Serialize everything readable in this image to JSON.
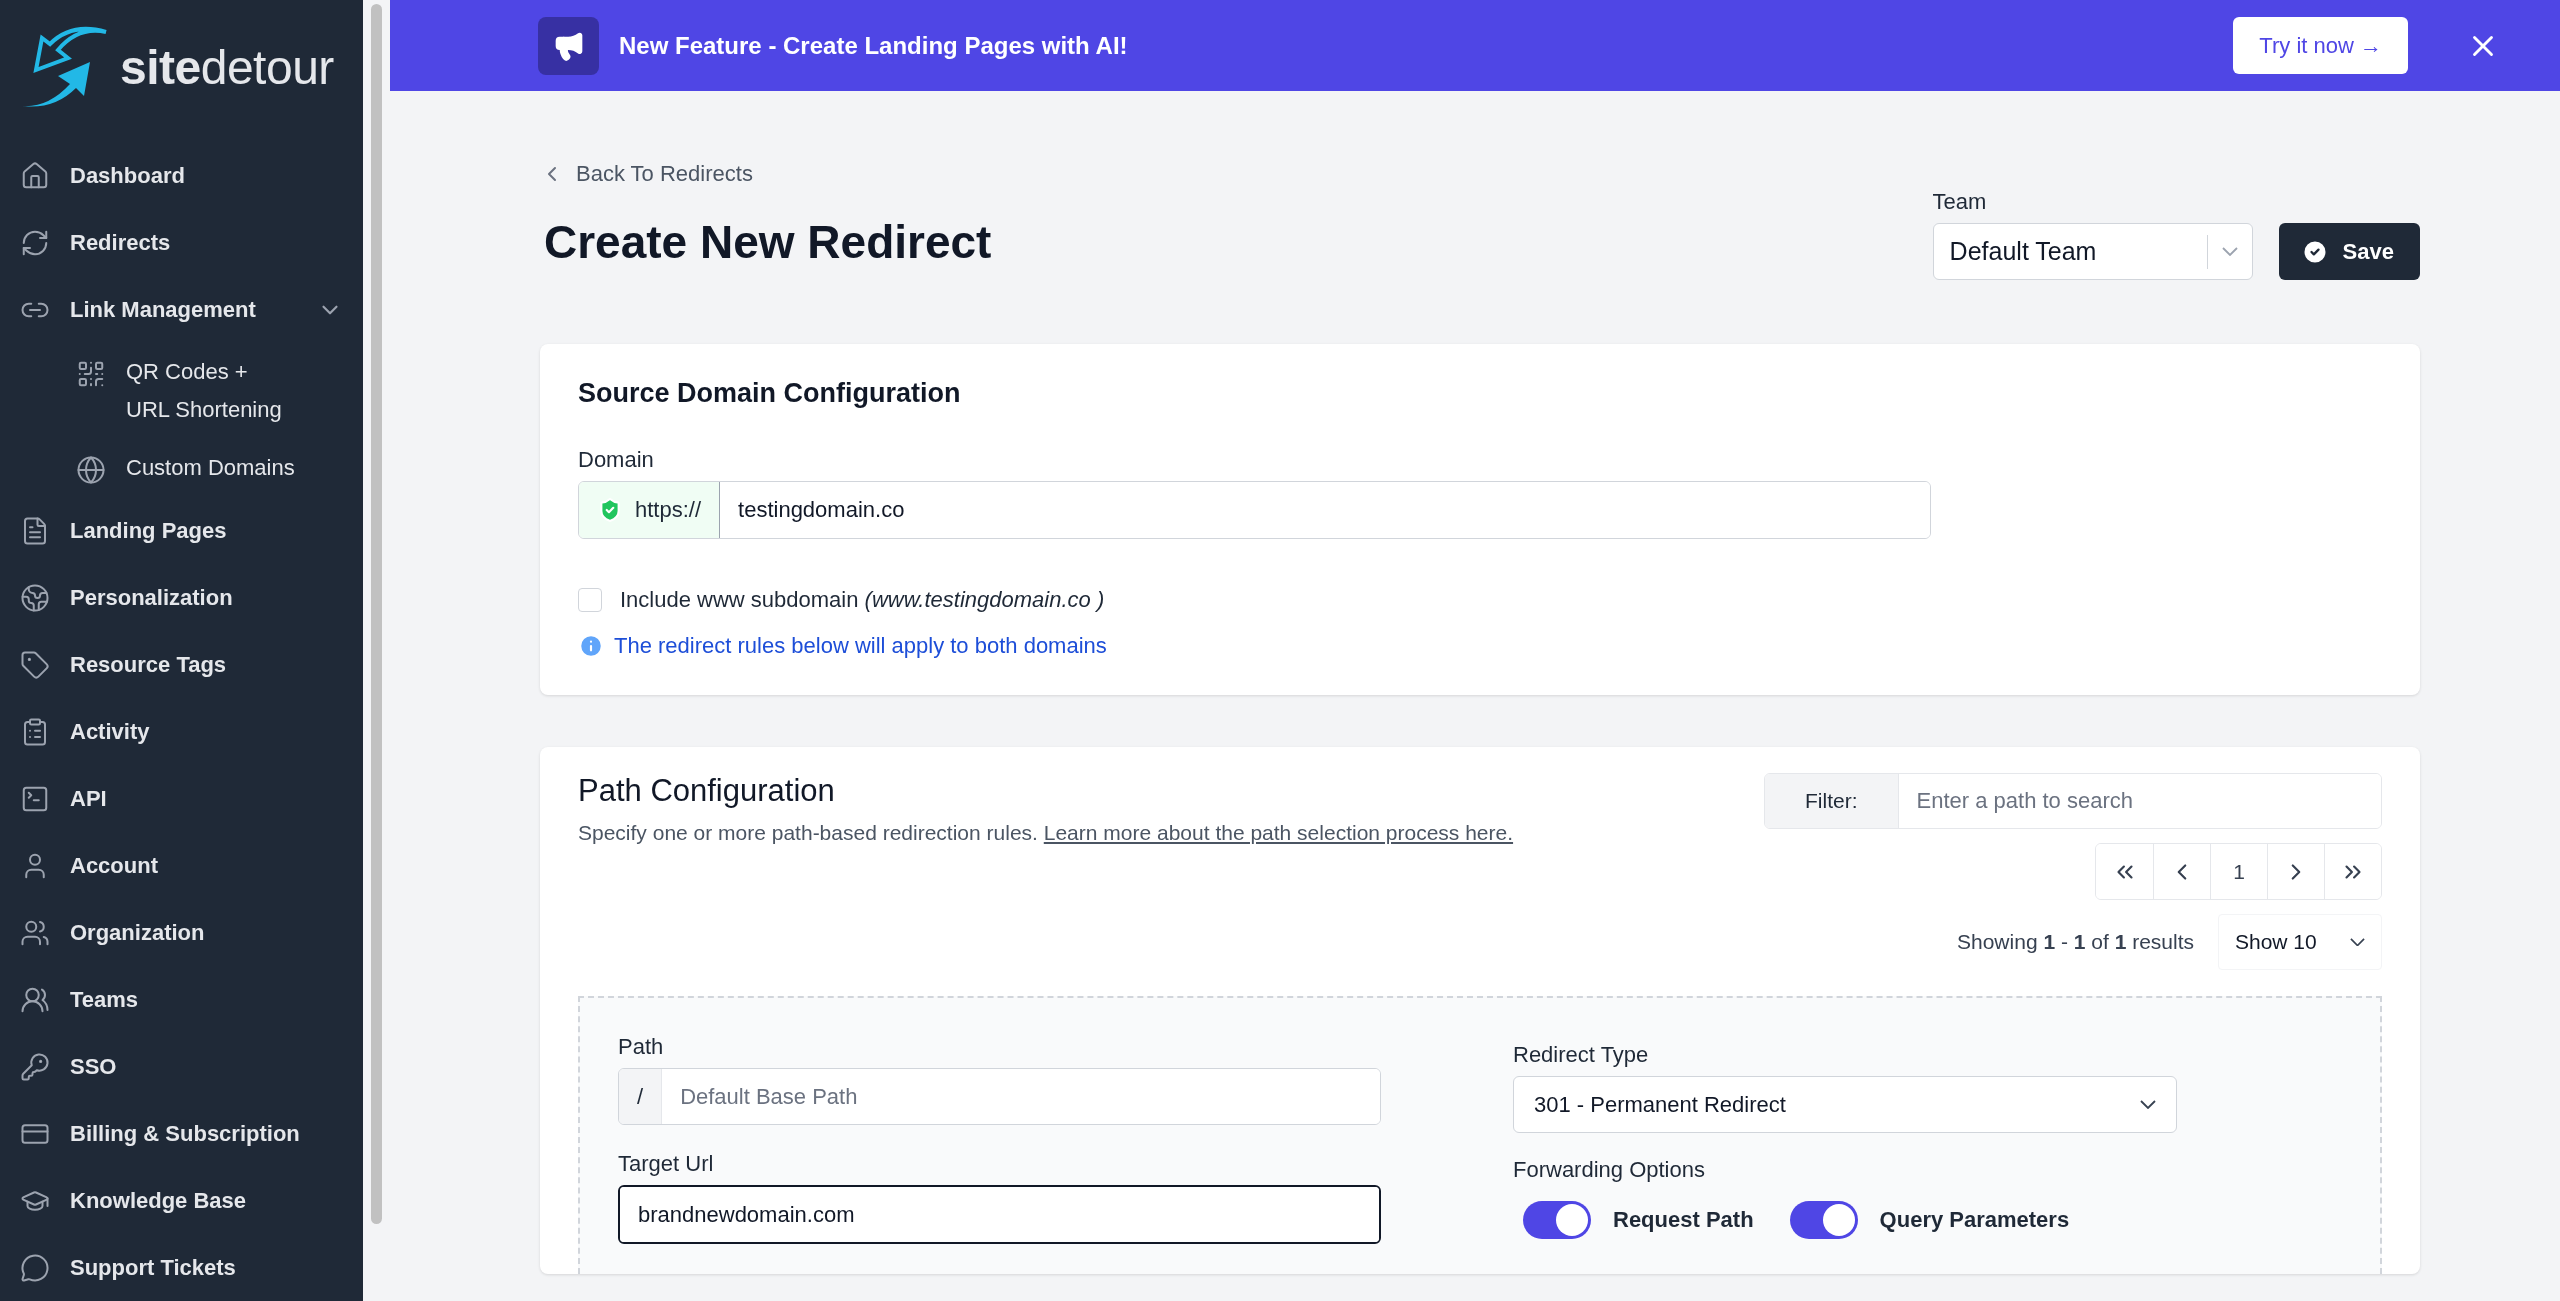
{
  "sidebar": {
    "logo": {
      "part1": "site",
      "part2": "detour"
    },
    "items": [
      {
        "label": "Dashboard",
        "selected": false
      },
      {
        "label": "Redirects",
        "selected": false
      },
      {
        "label": "Link Management",
        "selected": false,
        "expanded": true,
        "children": [
          {
            "label": "QR Codes + URL Shortening"
          },
          {
            "label": "Custom Domains"
          }
        ]
      },
      {
        "label": "Landing Pages",
        "selected": false
      },
      {
        "label": "Personalization",
        "selected": false
      },
      {
        "label": "Resource Tags",
        "selected": false
      },
      {
        "label": "Activity",
        "selected": false
      },
      {
        "label": "API",
        "selected": false
      },
      {
        "label": "Account",
        "selected": false
      },
      {
        "label": "Organization",
        "selected": false
      },
      {
        "label": "Teams",
        "selected": false
      },
      {
        "label": "SSO",
        "selected": false
      },
      {
        "label": "Billing & Subscription",
        "selected": false
      },
      {
        "label": "Knowledge Base",
        "selected": false
      },
      {
        "label": "Support Tickets",
        "selected": false
      }
    ]
  },
  "banner": {
    "text": "New Feature - Create Landing Pages with AI!",
    "button": "Try it now →"
  },
  "header": {
    "back": "Back To Redirects",
    "title": "Create New Redirect",
    "team_label": "Team",
    "team_value": "Default Team",
    "save": "Save"
  },
  "source_card": {
    "title": "Source Domain Configuration",
    "domain_label": "Domain",
    "prefix": "https://",
    "domain_value": "testingdomain.co",
    "include_www": {
      "text": "Include www subdomain *(www.testingdomain.co )*",
      "checked": false
    },
    "info": "The redirect rules below will apply to both domains"
  },
  "path_card": {
    "title": "Path Configuration",
    "subtitle": "Specify one or more path-based redirection rules.",
    "link": "Learn more about the path selection process here.",
    "filter_label": "Filter:",
    "filter_placeholder": "Enter a path to search",
    "pagination": [
      {
        "kind": "first"
      },
      {
        "kind": "prev"
      },
      {
        "kind": "page",
        "label": "1"
      },
      {
        "kind": "next"
      },
      {
        "kind": "last"
      }
    ],
    "showing": "Showing **1** - **1** of **1** results",
    "page_size": "Show 10",
    "rule": {
      "path_label": "Path",
      "path_prefix": "/",
      "path_placeholder": "Default Base Path",
      "target_label": "Target Url",
      "target_value": "brandnewdomain.com",
      "redirect_type_label": "Redirect Type",
      "redirect_type_value": "301 - Permanent Redirect",
      "forwarding_label": "Forwarding Options",
      "toggles": [
        {
          "label": "Request Path",
          "on": true
        },
        {
          "label": "Query Parameters",
          "on": true
        }
      ]
    }
  }
}
